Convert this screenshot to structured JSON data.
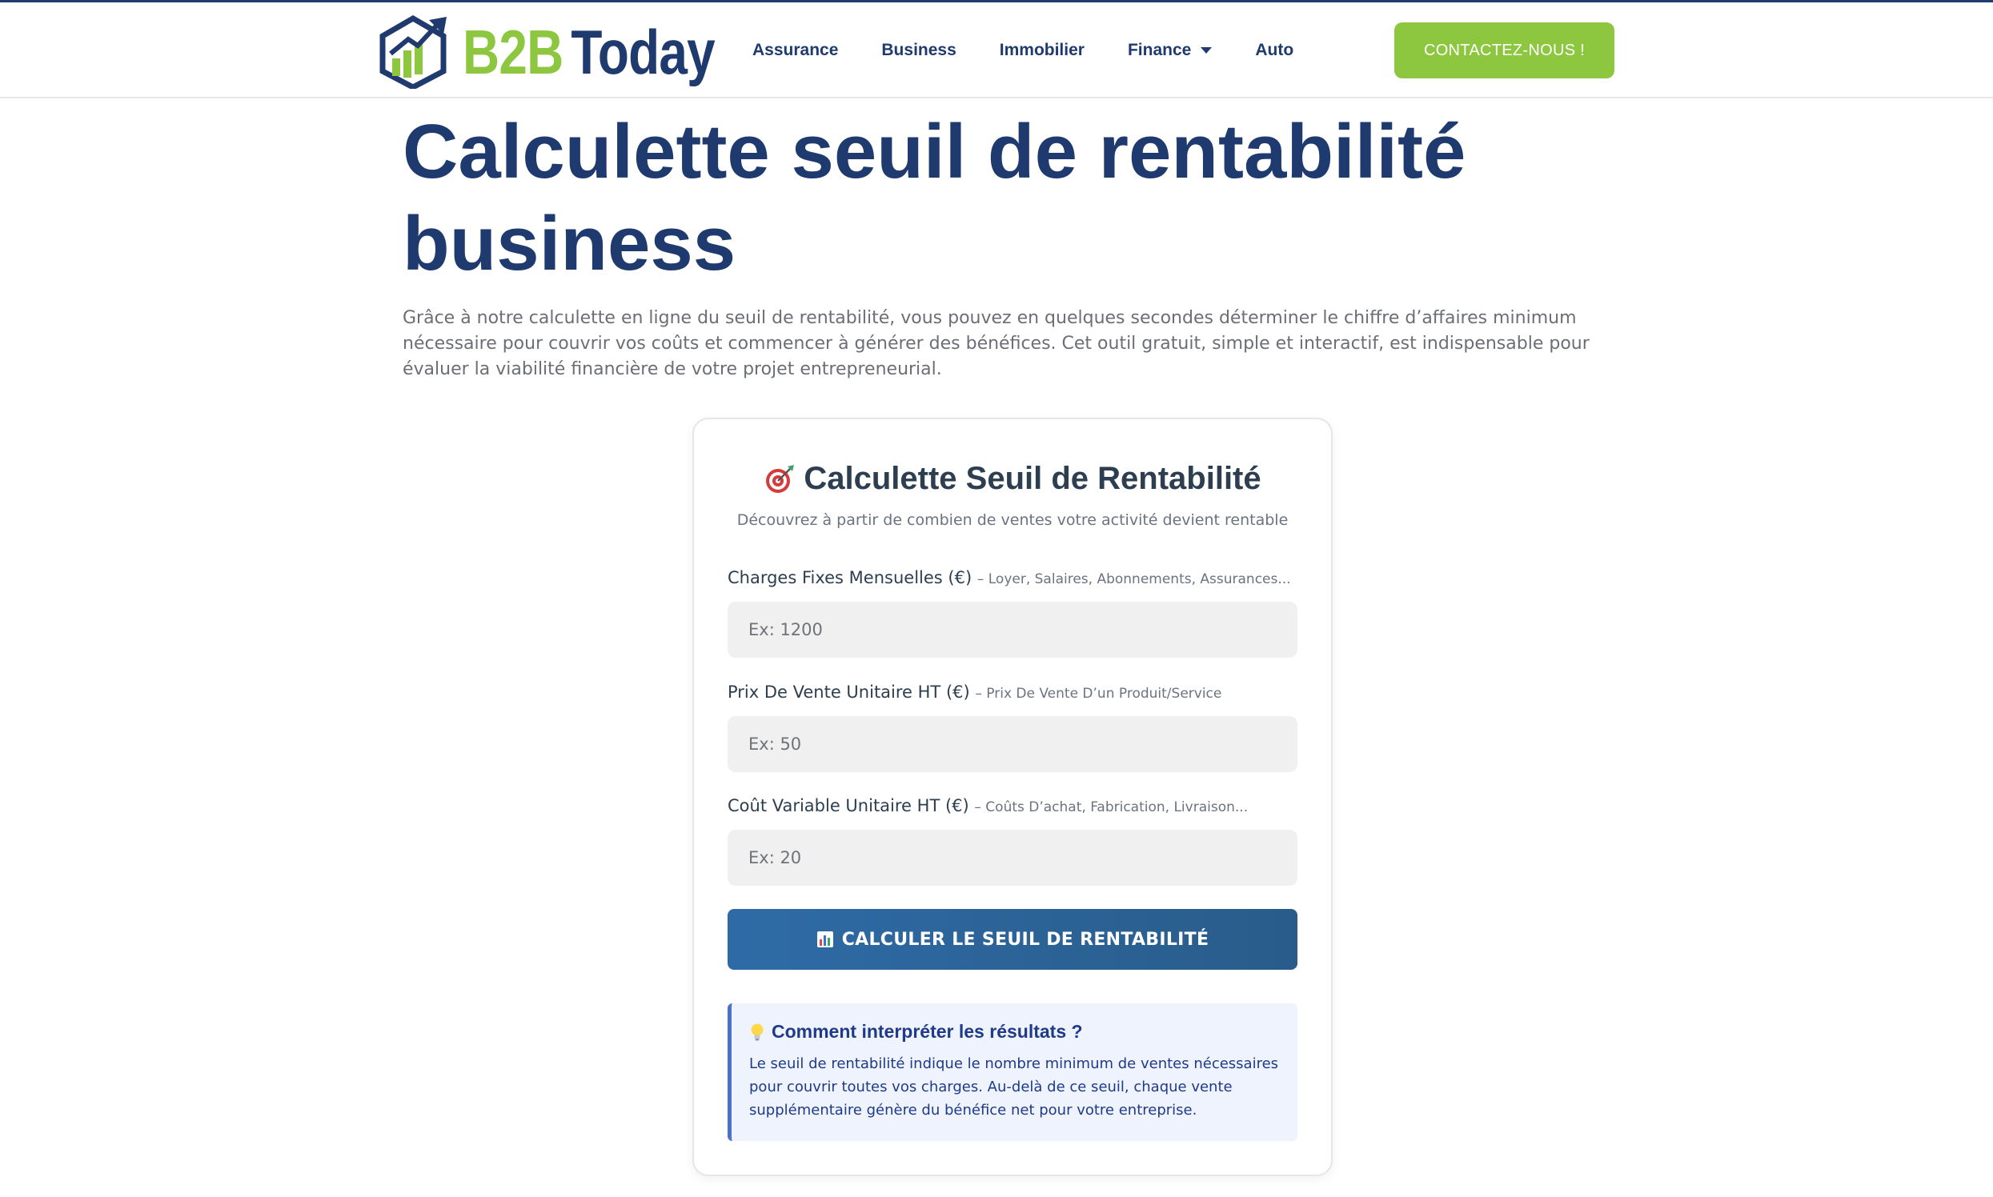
{
  "brand": {
    "logo_part1": "B2B",
    "logo_part2": "Today",
    "primary_color": "#1f3a6e",
    "accent_color": "#8dc63f"
  },
  "nav": {
    "items": [
      {
        "label": "Assurance"
      },
      {
        "label": "Business"
      },
      {
        "label": "Immobilier"
      },
      {
        "label": "Finance",
        "has_dropdown": true
      },
      {
        "label": "Auto"
      }
    ],
    "cta_label": "CONTACTEZ-NOUS !"
  },
  "page": {
    "title": "Calculette seuil de rentabilité business",
    "intro": "Grâce à notre calculette en ligne du seuil de rentabilité, vous pouvez en quelques secondes déterminer le chiffre d’affaires minimum nécessaire pour couvrir vos coûts et commencer à générer des bénéfices. Cet outil gratuit, simple et interactif, est indispensable pour évaluer la viabilité financière de votre projet entrepreneurial."
  },
  "calculator": {
    "title": "Calculette Seuil de Rentabilité",
    "title_icon": "target-icon",
    "subtitle": "Découvrez à partir de combien de ventes votre activité devient rentable",
    "fields": [
      {
        "label": "Charges Fixes Mensuelles (€)",
        "hint": "– Loyer, Salaires, Abonnements, Assurances...",
        "placeholder": "Ex: 1200",
        "value": ""
      },
      {
        "label": "Prix De Vente Unitaire HT (€)",
        "hint": "– Prix De Vente D’un Produit/Service",
        "placeholder": "Ex: 50",
        "value": ""
      },
      {
        "label": "Coût Variable Unitaire HT (€)",
        "hint": "– Coûts D’achat, Fabrication, Livraison...",
        "placeholder": "Ex: 20",
        "value": ""
      }
    ],
    "button_label": "CALCULER LE SEUIL DE RENTABILITÉ",
    "button_icon": "bar-chart-icon",
    "info": {
      "icon": "lightbulb-icon",
      "title": "Comment interpréter les résultats ?",
      "text": "Le seuil de rentabilité indique le nombre minimum de ventes nécessaires pour couvrir toutes vos charges. Au-delà de ce seuil, chaque vente supplémentaire génère du bénéfice net pour votre entreprise."
    }
  }
}
